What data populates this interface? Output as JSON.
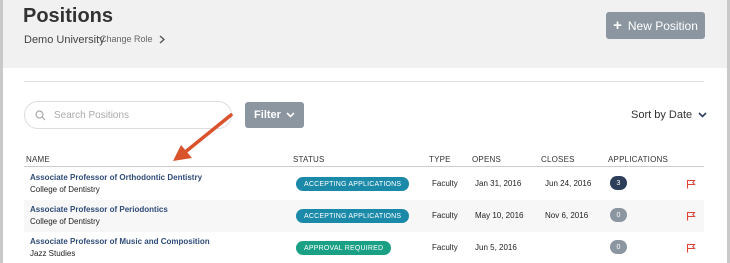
{
  "header": {
    "title": "Positions",
    "org_name": "Demo University",
    "change_role_label": "Change Role",
    "new_position_label": "New Position"
  },
  "toolbar": {
    "search_placeholder": "Search Positions",
    "filter_label": "Filter",
    "sort_label": "Sort by Date"
  },
  "table": {
    "columns": [
      "NAME",
      "STATUS",
      "TYPE",
      "OPENS",
      "CLOSES",
      "APPLICATIONS"
    ],
    "rows": [
      {
        "title": "Associate Professor of Orthodontic Dentistry",
        "department": "College of Dentistry",
        "status": "ACCEPTING APPLICATIONS",
        "status_color": "#1a8aa8",
        "type": "Faculty",
        "opens": "Jan 31, 2016",
        "closes": "Jun 24, 2016",
        "applications": "3"
      },
      {
        "title": "Associate Professor of Periodontics",
        "department": "College of Dentistry",
        "status": "ACCEPTING APPLICATIONS",
        "status_color": "#1a8aa8",
        "type": "Faculty",
        "opens": "May 10, 2016",
        "closes": "Nov 6, 2016",
        "applications": "0"
      },
      {
        "title": "Associate Professor of Music and Composition",
        "department": "Jazz Studies",
        "status": "APPROVAL REQUIRED",
        "status_color": "#1aa085",
        "type": "Faculty",
        "opens": "Jun 5, 2016",
        "closes": "",
        "applications": "0"
      }
    ]
  },
  "colors": {
    "accent_button": "#8c96a0",
    "link": "#2f4b78",
    "flag": "#e0433a",
    "annotation_arrow": "#d9532c"
  }
}
